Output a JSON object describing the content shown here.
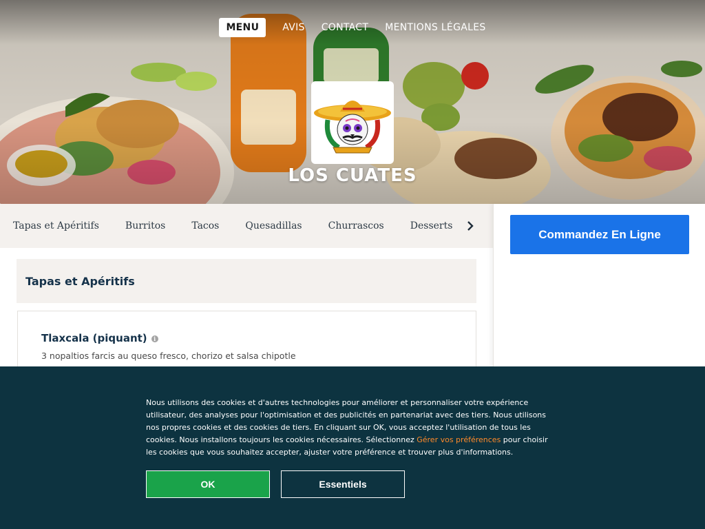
{
  "nav": {
    "items": [
      {
        "label": "MENU",
        "active": true
      },
      {
        "label": "AVIS",
        "active": false
      },
      {
        "label": "CONTACT",
        "active": false
      },
      {
        "label": "MENTIONS LÉGALES",
        "active": false
      }
    ]
  },
  "brand": {
    "name": "LOS CUATES",
    "logo_icon": "skull-sombrero-logo-icon"
  },
  "categories": {
    "items": [
      "Tapas et Apéritifs",
      "Burritos",
      "Tacos",
      "Quesadillas",
      "Churrascos",
      "Desserts"
    ],
    "next_icon": "chevron-right-icon"
  },
  "section": {
    "title": "Tapas et Apéritifs"
  },
  "menu_item": {
    "title": "Tlaxcala (piquant)",
    "info_icon": "info-icon",
    "description": "3 nopaltios farcis au queso fresco, chorizo et salsa chipotle"
  },
  "sidebar": {
    "order_label": "Commandez En Ligne"
  },
  "cookie": {
    "text_before": "Nous utilisons des cookies et d'autres technologies pour améliorer et personnaliser votre expérience utilisateur, des analyses pour l'optimisation et des publicités en partenariat avec des tiers. Nous utilisons nos propres cookies et des cookies de tiers. En cliquant sur OK, vous acceptez l'utilisation de tous les cookies. Nous installons toujours les cookies nécessaires. Sélectionnez ",
    "link_text": "Gérer vos préférences",
    "text_after": " pour choisir les cookies que vous souhaitez accepter, ajuster votre préférence et trouver plus d'informations.",
    "ok_label": "OK",
    "essential_label": "Essentiels"
  },
  "colors": {
    "order_button": "#1a73e8",
    "cookie_bg": "#0d3340",
    "ok_button": "#1aa34a",
    "link": "#ff8a2a",
    "heading": "#15324a"
  }
}
